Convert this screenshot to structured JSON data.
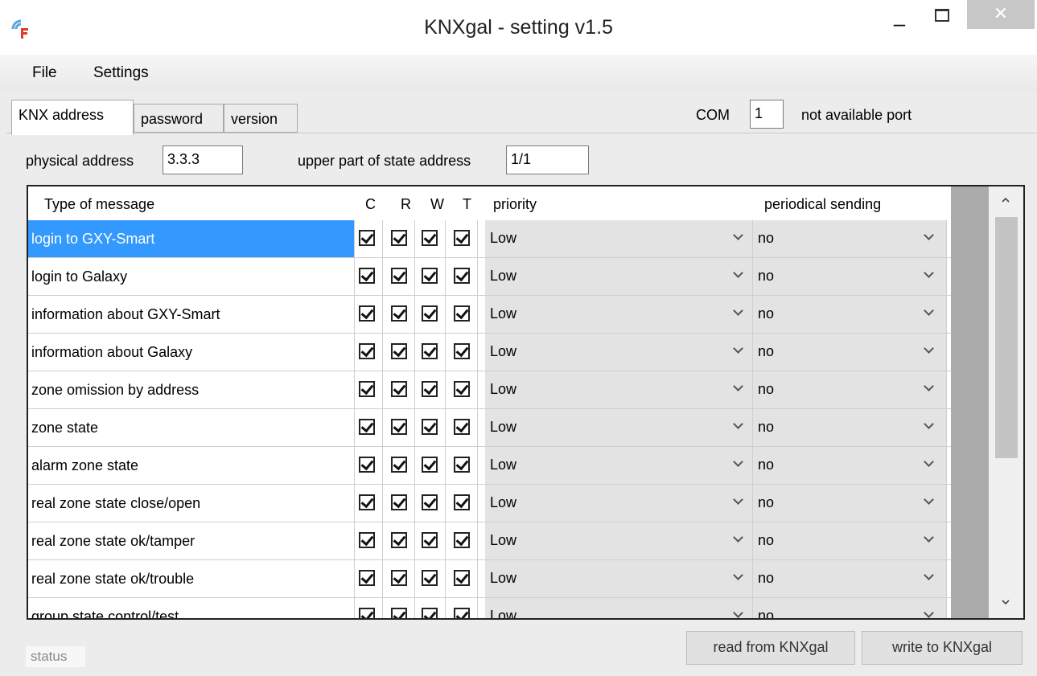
{
  "window": {
    "title": "KNXgal - setting v1.5",
    "minimize": "–",
    "close": "✕"
  },
  "menu": {
    "file": "File",
    "settings": "Settings"
  },
  "tabs": {
    "knx": "KNX address",
    "password": "password",
    "version": "version"
  },
  "com": {
    "label": "COM",
    "value": "1",
    "status": "not available port"
  },
  "physical": {
    "label": "physical address",
    "value": "3.3.3"
  },
  "state_addr": {
    "label": "upper part of state address",
    "value": "1/1"
  },
  "grid": {
    "headers": {
      "type": "Type of message",
      "c": "C",
      "r": "R",
      "w": "W",
      "t": "T",
      "priority": "priority",
      "periodic": "periodical sending"
    },
    "rows": [
      {
        "type": "login to GXY-Smart",
        "priority": "Low",
        "periodic": "no"
      },
      {
        "type": "login to Galaxy",
        "priority": "Low",
        "periodic": "no"
      },
      {
        "type": "information about GXY-Smart",
        "priority": "Low",
        "periodic": "no"
      },
      {
        "type": "information about Galaxy",
        "priority": "Low",
        "periodic": "no"
      },
      {
        "type": "zone omission by address",
        "priority": "Low",
        "periodic": "no"
      },
      {
        "type": "zone state",
        "priority": "Low",
        "periodic": "no"
      },
      {
        "type": "alarm zone state",
        "priority": "Low",
        "periodic": "no"
      },
      {
        "type": "real zone state close/open",
        "priority": "Low",
        "periodic": "no"
      },
      {
        "type": "real zone state ok/tamper",
        "priority": "Low",
        "periodic": "no"
      },
      {
        "type": "real zone state ok/trouble",
        "priority": "Low",
        "periodic": "no"
      },
      {
        "type": "group state control/test",
        "priority": "Low",
        "periodic": "no"
      }
    ]
  },
  "status": "status",
  "buttons": {
    "read": "read from KNXgal",
    "write": "write to KNXgal"
  },
  "colors": {
    "selection": "#3399ff",
    "close_button": "#c7c7c7"
  }
}
